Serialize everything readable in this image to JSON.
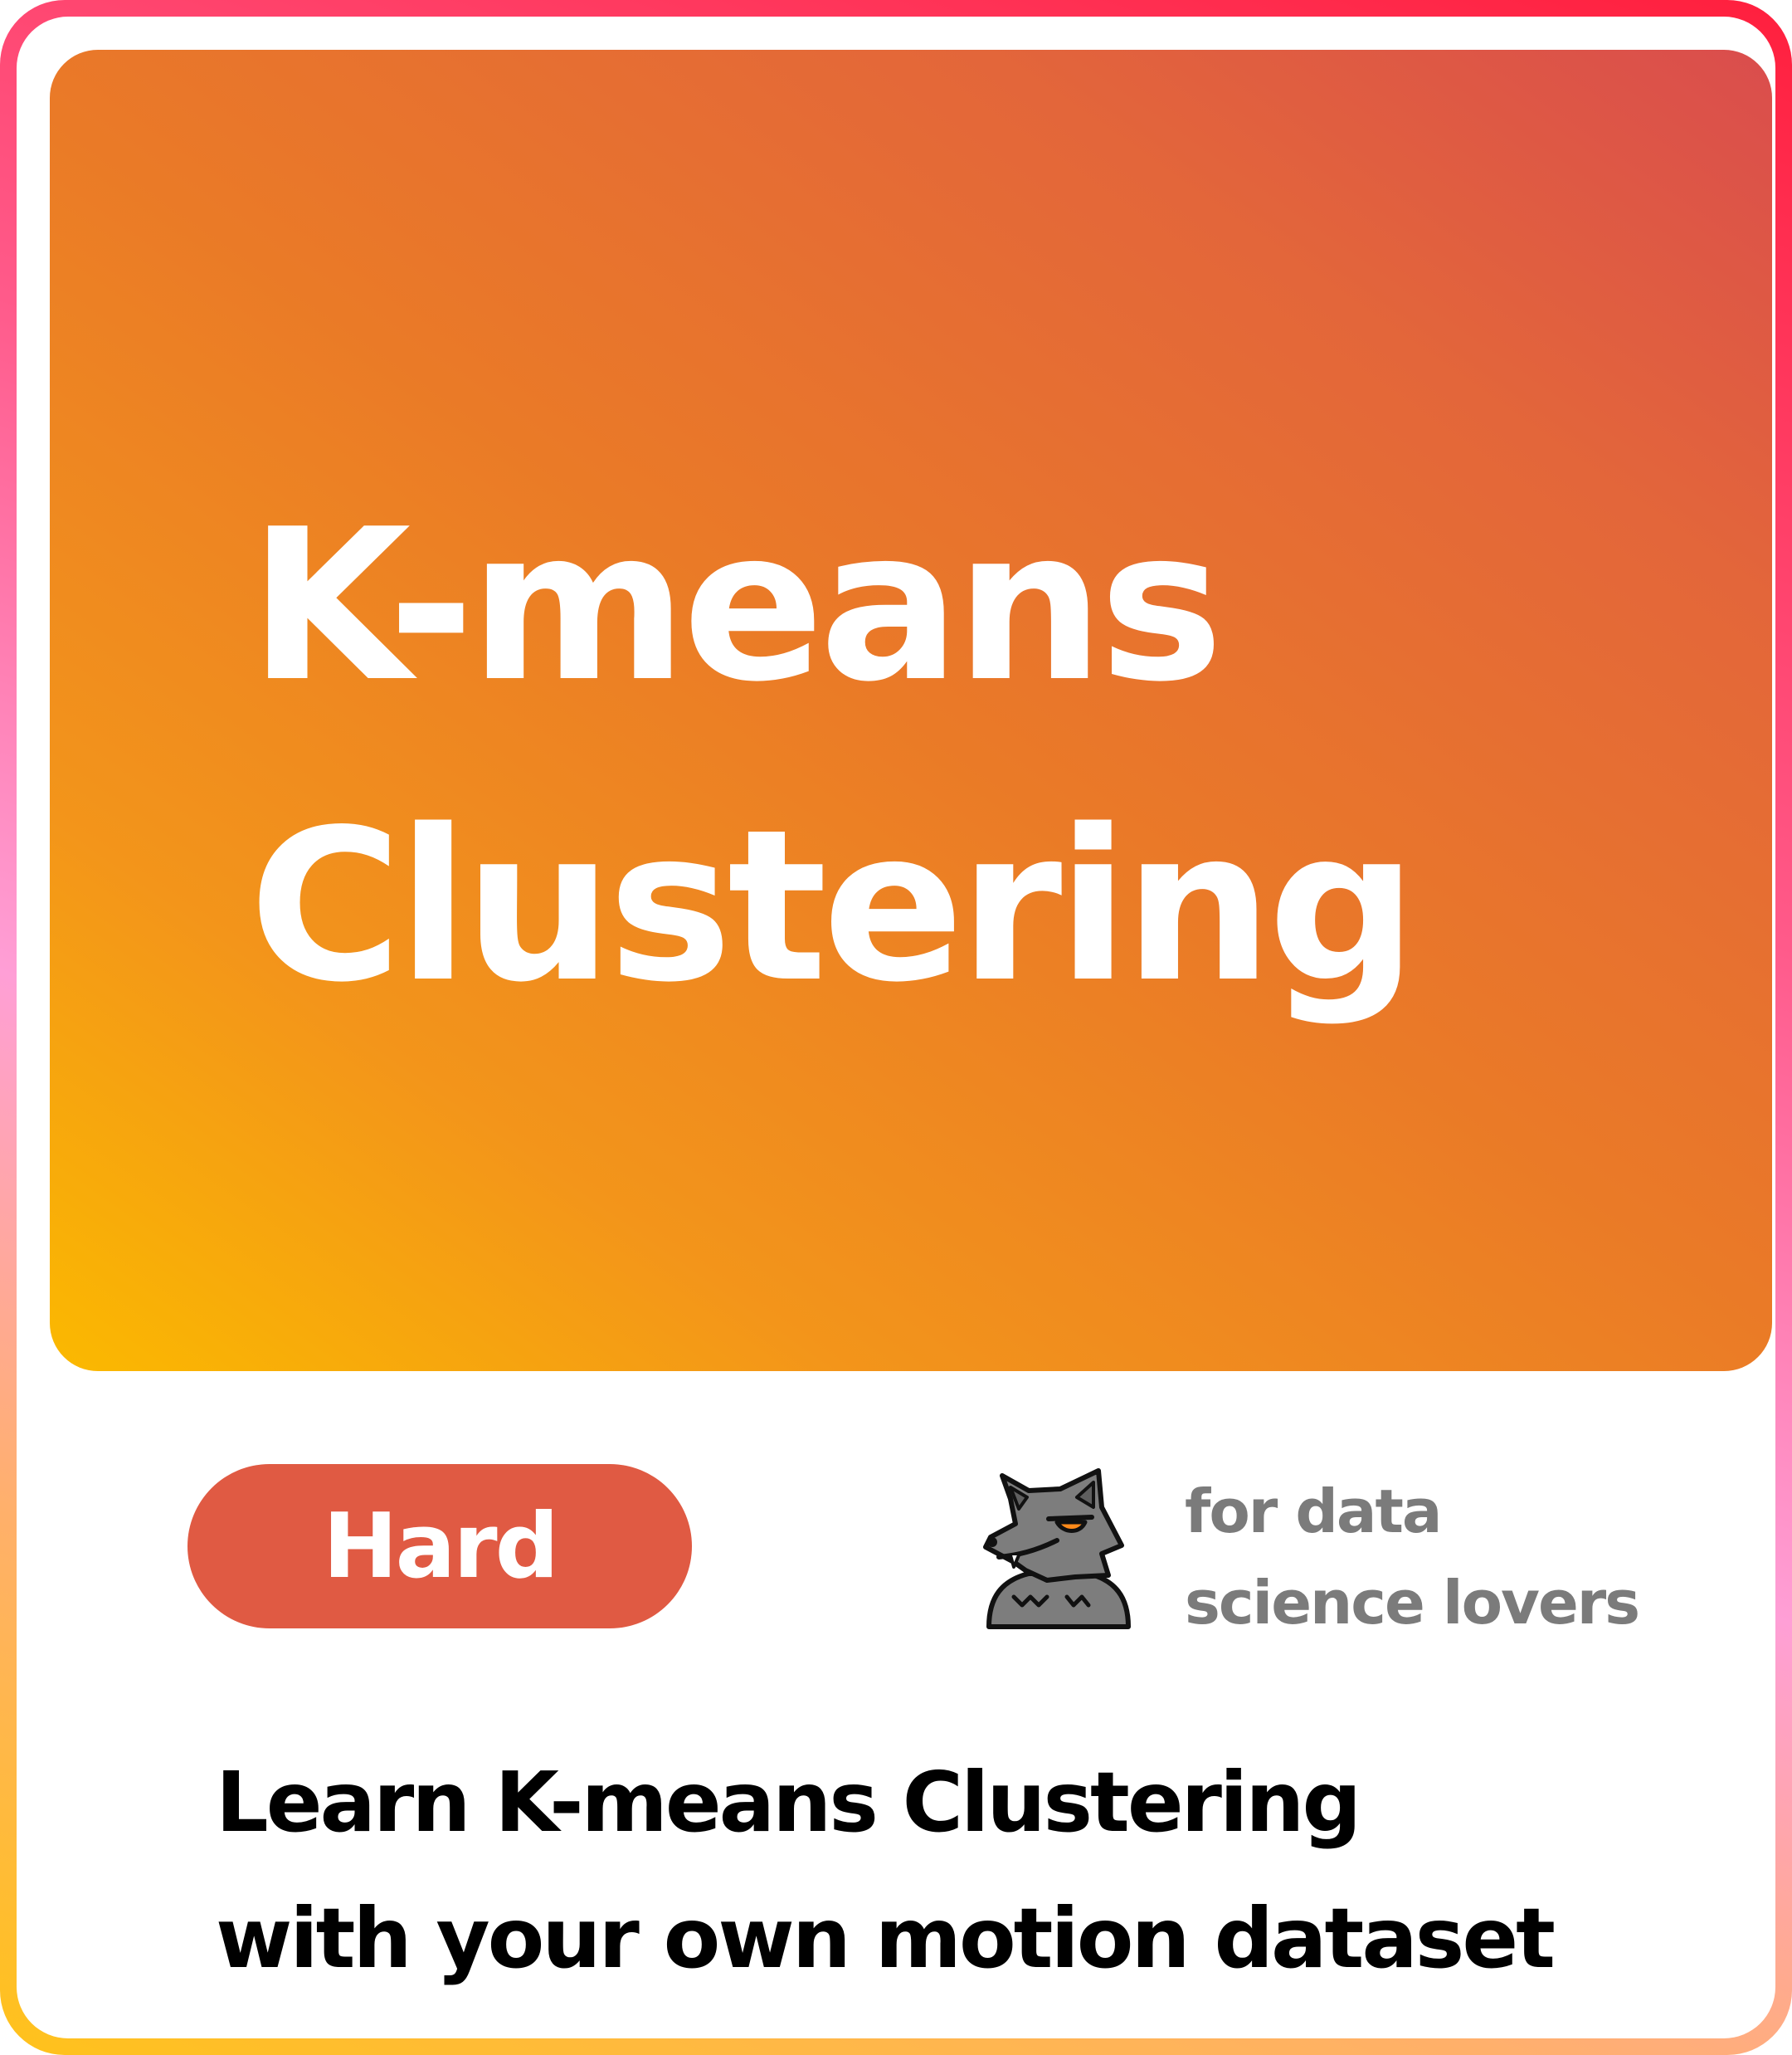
{
  "card": {
    "title_lines": [
      "K-means",
      "Clustering"
    ],
    "difficulty": "Hard",
    "audience_lines": [
      "for data",
      "science lovers"
    ],
    "mascot_icon": "wolf-icon",
    "description_lines": [
      "Learn K-means Clustering",
      "with your own motion dataset"
    ]
  },
  "colors": {
    "hero_gradient": [
      "#fbb900",
      "#ea7a27",
      "#da4d4d"
    ],
    "badge": "#e05a43",
    "audience_text": "#7b7b7b",
    "border_gradient": [
      "#ff1f3d",
      "#ff9fd6",
      "#ffc21a"
    ]
  }
}
